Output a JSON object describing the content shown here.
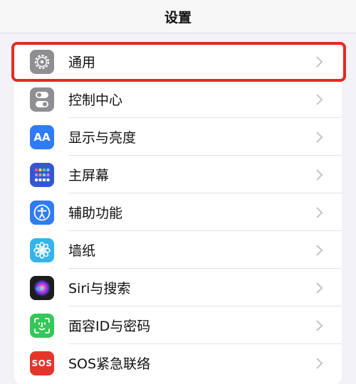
{
  "header": {
    "title": "设置"
  },
  "settings": {
    "items": [
      {
        "label": "通用",
        "icon": "gear-icon",
        "color": "#8e8e93"
      },
      {
        "label": "控制中心",
        "icon": "toggles-icon",
        "color": "#8e8e93"
      },
      {
        "label": "显示与亮度",
        "icon": "display-aa-icon",
        "color": "#2f7cf6"
      },
      {
        "label": "主屏幕",
        "icon": "home-screen-grid-icon",
        "color": "#3357d4"
      },
      {
        "label": "辅助功能",
        "icon": "accessibility-icon",
        "color": "#2f7cf6"
      },
      {
        "label": "墙纸",
        "icon": "flower-icon",
        "color": "#35b3ea"
      },
      {
        "label": "Siri与搜索",
        "icon": "siri-icon",
        "color": "#1c1c1e"
      },
      {
        "label": "面容ID与密码",
        "icon": "face-id-icon",
        "color": "#34c759"
      },
      {
        "label": "SOS紧急联络",
        "icon": "sos-icon",
        "color": "#e5352b"
      }
    ],
    "aa_glyph": "AA",
    "sos_glyph": "SOS"
  },
  "highlight_color": "#e32b22"
}
